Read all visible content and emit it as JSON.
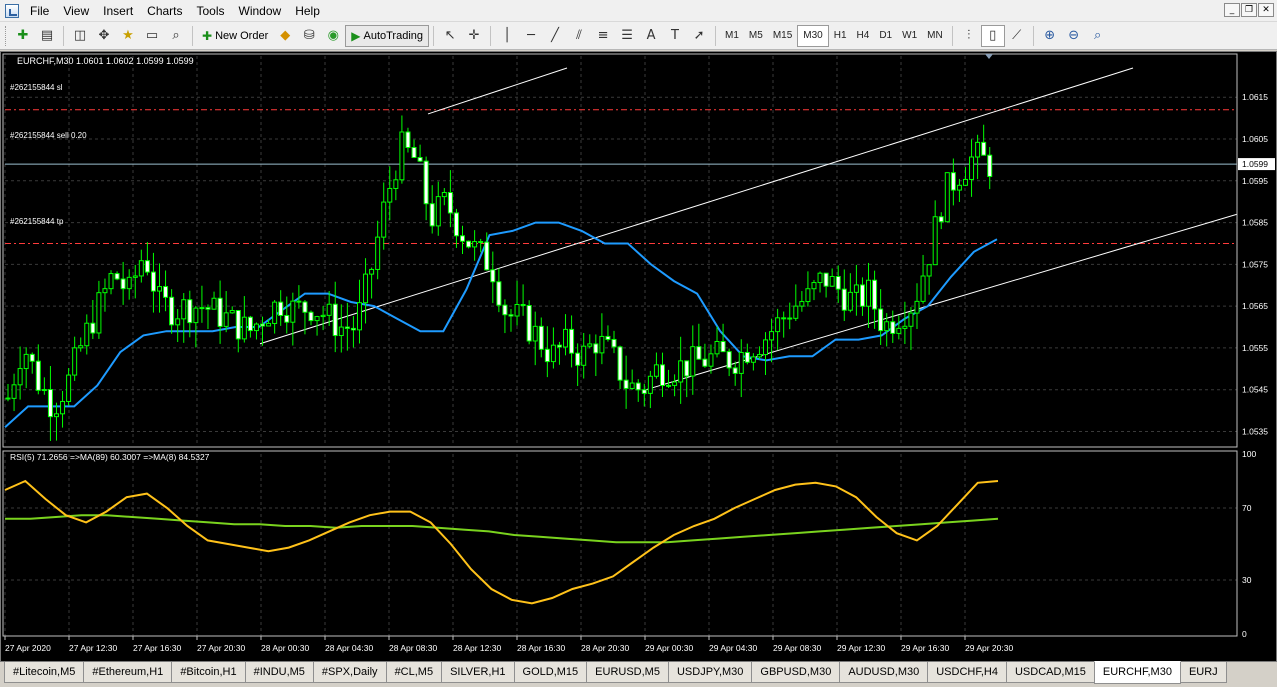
{
  "menu": [
    "File",
    "View",
    "Insert",
    "Charts",
    "Tools",
    "Window",
    "Help"
  ],
  "toolbar": {
    "new_order": "New Order",
    "autotrading": "AutoTrading",
    "timeframes": [
      "M1",
      "M5",
      "M15",
      "M30",
      "H1",
      "H4",
      "D1",
      "W1",
      "MN"
    ],
    "active_timeframe": "M30"
  },
  "chart": {
    "header": "EURCHF,M30  1.0601 1.0602 1.0599 1.0599",
    "order_labels": {
      "sl": "#262155844 sl",
      "sell": "#262155844 sell 0.20",
      "tp": "#262155844 tp"
    },
    "price_ticks": [
      "1.0615",
      "1.0605",
      "1.0595",
      "1.0585",
      "1.0575",
      "1.0565",
      "1.0555",
      "1.0545",
      "1.0535"
    ],
    "current_price": "1.0599",
    "time_labels": [
      "27 Apr 2020",
      "27 Apr 12:30",
      "27 Apr 16:30",
      "27 Apr 20:30",
      "28 Apr 00:30",
      "28 Apr 04:30",
      "28 Apr 08:30",
      "28 Apr 12:30",
      "28 Apr 16:30",
      "28 Apr 20:30",
      "29 Apr 00:30",
      "29 Apr 04:30",
      "29 Apr 08:30",
      "29 Apr 12:30",
      "29 Apr 16:30",
      "29 Apr 20:30"
    ],
    "colors": {
      "background": "#000000",
      "candle": "#00ff00",
      "baseline": "#1e9bff",
      "order_line": "#ff3b3b",
      "channel": "#ffffff",
      "rsi": "#ffc21a",
      "rsi_ma": "#7ad31e"
    }
  },
  "rsi": {
    "header": "RSI(5) 71.2656  =>MA(89) 60.3007  =>MA(8) 84.5327",
    "ticks": [
      "100",
      "70",
      "30",
      "0"
    ]
  },
  "chart_data": {
    "type": "candlestick",
    "symbol": "EURCHF",
    "timeframe": "M30",
    "ylim": [
      1.0532,
      1.0622
    ],
    "levels": {
      "sl": 1.0612,
      "sell": 1.0599,
      "tp": 1.058
    },
    "close_path": [
      1.0543,
      1.0556,
      1.0547,
      1.0541,
      1.0547,
      1.0557,
      1.0565,
      1.0573,
      1.0568,
      1.0578,
      1.0566,
      1.0564,
      1.0565,
      1.0565,
      1.0563,
      1.0561,
      1.0559,
      1.0563,
      1.0566,
      1.0564,
      1.0565,
      1.0563,
      1.056,
      1.056,
      1.0573,
      1.059,
      1.0603,
      1.06,
      1.0586,
      1.059,
      1.0583,
      1.0578,
      1.0575,
      1.0563,
      1.0562,
      1.0558,
      1.0553,
      1.0556,
      1.0553,
      1.0557,
      1.0553,
      1.0546,
      1.0545,
      1.055,
      1.055,
      1.0551,
      1.0552,
      1.0553,
      1.0552,
      1.0555,
      1.0557,
      1.0561,
      1.0565,
      1.0567,
      1.0572,
      1.0569,
      1.0566,
      1.0568,
      1.056,
      1.0563,
      1.0566,
      1.0578,
      1.0592,
      1.0597,
      1.0601,
      1.0599
    ],
    "baseline": [
      1.0536,
      1.0541,
      1.0541,
      1.0541,
      1.0546,
      1.0554,
      1.0558,
      1.0559,
      1.0559,
      1.0559,
      1.056,
      1.056,
      1.0564,
      1.0568,
      1.0568,
      1.0566,
      1.0565,
      1.0562,
      1.0559,
      1.0559,
      1.0569,
      1.0582,
      1.0583,
      1.0585,
      1.0585,
      1.0583,
      1.058,
      1.058,
      1.0575,
      1.0571,
      1.0568,
      1.0559,
      1.0553,
      1.0552,
      1.0553,
      1.0553,
      1.0557,
      1.0557,
      1.0558,
      1.0562,
      1.0565,
      1.0572,
      1.0578,
      1.0581
    ],
    "rsi": [
      80,
      85,
      75,
      66,
      62,
      68,
      76,
      78,
      70,
      60,
      52,
      50,
      48,
      46,
      48,
      52,
      57,
      62,
      66,
      68,
      68,
      62,
      50,
      36,
      25,
      19,
      17,
      20,
      25,
      28,
      32,
      40,
      48,
      55,
      60,
      64,
      70,
      75,
      80,
      83,
      84,
      82,
      76,
      65,
      56,
      52,
      60,
      72,
      84,
      85
    ],
    "rsi_ma": [
      64,
      64,
      65,
      66,
      66,
      65,
      64,
      63,
      62,
      61,
      61,
      60,
      60,
      59,
      60,
      60,
      60,
      59,
      58,
      57,
      55,
      54,
      53,
      52,
      51,
      51,
      51,
      52,
      53,
      54,
      55,
      56,
      57,
      58,
      59,
      60,
      61,
      62,
      63,
      64
    ]
  }
}
